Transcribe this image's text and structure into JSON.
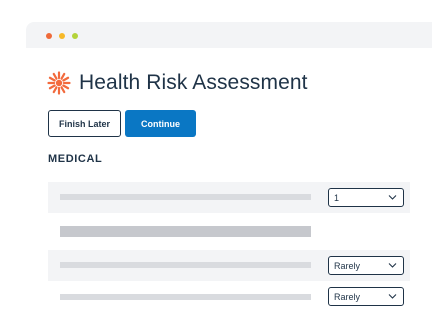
{
  "colors": {
    "titlebar_bg": "#f3f4f6",
    "dot_red": "#ef6a3a",
    "dot_yellow": "#f7b928",
    "dot_green": "#b4d33a",
    "logo_orange": "#f26a3d",
    "text_navy": "#1f3347",
    "primary_blue": "#0a77c4"
  },
  "header": {
    "title": "Health Risk Assessment",
    "logo_icon": "starburst-logo-icon"
  },
  "actions": {
    "finish_later_label": "Finish Later",
    "continue_label": "Continue"
  },
  "section": {
    "heading": "MEDICAL"
  },
  "questions": [
    {
      "answer": "1"
    },
    {
      "answer": ""
    },
    {
      "answer": "Rarely"
    },
    {
      "answer": "Rarely"
    }
  ]
}
